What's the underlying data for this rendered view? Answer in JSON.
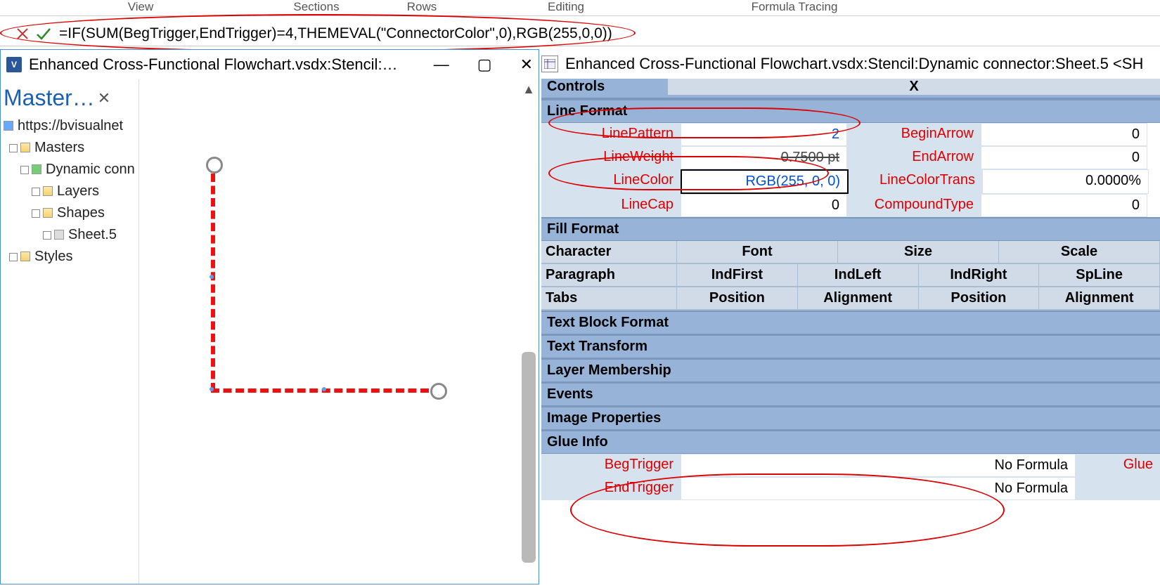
{
  "ribbon_groups": [
    "View",
    "Sections",
    "Rows",
    "Editing",
    "Formula Tracing"
  ],
  "ribbon_positions": [
    150,
    390,
    540,
    760,
    1040
  ],
  "formula": "=IF(SUM(BegTrigger,EndTrigger)=4,THEMEVAL(\"ConnectorColor\",0),RGB(255,0,0))",
  "doc_title": "Enhanced Cross-Functional Flowchart.vsdx:Stencil:…",
  "sidebar_title": "Master…",
  "tree": {
    "root": "https://bvisualnet",
    "masters": "Masters",
    "dynamic": "Dynamic conn",
    "layers": "Layers",
    "shapes": "Shapes",
    "sheet5": "Sheet.5",
    "styles": "Styles"
  },
  "sheet_title": "Enhanced Cross-Functional Flowchart.vsdx:Stencil:Dynamic connector:Sheet.5 <SH",
  "controls_partial": "Controls",
  "sections": {
    "line_format": "Line Format",
    "fill_format": "Fill Format",
    "character": "Character",
    "paragraph": "Paragraph",
    "tabs": "Tabs",
    "text_block": "Text Block Format",
    "text_transform": "Text Transform",
    "layer_membership": "Layer Membership",
    "events": "Events",
    "image_properties": "Image Properties",
    "glue_info": "Glue Info"
  },
  "line_rows": [
    {
      "l1": "LinePattern",
      "v1": "2",
      "l2": "BeginArrow",
      "v2": "0"
    },
    {
      "l1": "LineWeight",
      "v1": "0.7500 pt",
      "l2": "EndArrow",
      "v2": "0"
    },
    {
      "l1": "LineColor",
      "v1": "RGB(255, 0, 0)",
      "l2": "LineColorTrans",
      "v2": "0.0000%"
    },
    {
      "l1": "LineCap",
      "v1": "0",
      "l2": "CompoundType",
      "v2": "0"
    }
  ],
  "char_cols": [
    "",
    "Font",
    "Size",
    "Scale"
  ],
  "para_cols": [
    "",
    "IndFirst",
    "IndLeft",
    "IndRight",
    "SpLine"
  ],
  "tabs_cols": [
    "",
    "Position",
    "Alignment",
    "Position",
    "Alignment"
  ],
  "glue_rows": [
    {
      "l": "BegTrigger",
      "v": "No Formula",
      "l2": "Glue"
    },
    {
      "l": "EndTrigger",
      "v": "No Formula",
      "l2": ""
    }
  ],
  "col_x": "X"
}
